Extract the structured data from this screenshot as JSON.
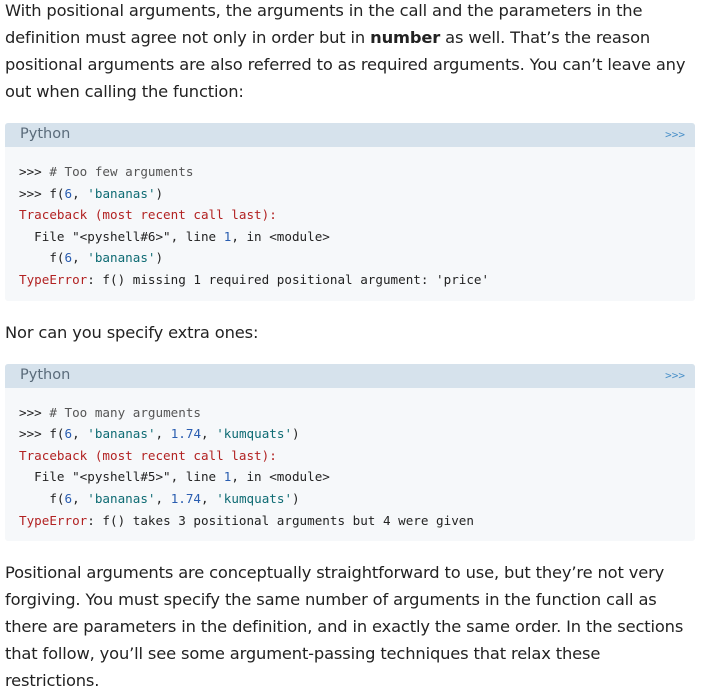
{
  "para1": {
    "before": "With positional arguments, the arguments in the call and the parameters in the definition must agree not only in order but in ",
    "bold": "number",
    "after": " as well. That’s the reason positional arguments are also referred to as required arguments. You can’t leave any out when calling the function:"
  },
  "block1": {
    "lang": "Python",
    "toggle": ">>>",
    "lines": {
      "l1_prompt": ">>> ",
      "l1_comment": "# Too few arguments",
      "l2_prompt": ">>> ",
      "l2_a": "f(",
      "l2_n1": "6",
      "l2_b": ", ",
      "l2_s1": "'bananas'",
      "l2_c": ")",
      "l3": "Traceback (most recent call last):",
      "l4_a": "  File \"<pyshell#6>\", line ",
      "l4_n": "1",
      "l4_b": ", in <module>",
      "l5_a": "    f(",
      "l5_n1": "6",
      "l5_b": ", ",
      "l5_s1": "'bananas'",
      "l5_c": ")",
      "l6_err": "TypeError",
      "l6_msg": ": f() missing 1 required positional argument: 'price'"
    }
  },
  "para2": "Nor can you specify extra ones:",
  "block2": {
    "lang": "Python",
    "toggle": ">>>",
    "lines": {
      "l1_prompt": ">>> ",
      "l1_comment": "# Too many arguments",
      "l2_prompt": ">>> ",
      "l2_a": "f(",
      "l2_n1": "6",
      "l2_b": ", ",
      "l2_s1": "'bananas'",
      "l2_c": ", ",
      "l2_n2": "1.74",
      "l2_d": ", ",
      "l2_s2": "'kumquats'",
      "l2_e": ")",
      "l3": "Traceback (most recent call last):",
      "l4_a": "  File \"<pyshell#5>\", line ",
      "l4_n": "1",
      "l4_b": ", in <module>",
      "l5_a": "    f(",
      "l5_n1": "6",
      "l5_b": ", ",
      "l5_s1": "'bananas'",
      "l5_c": ", ",
      "l5_n2": "1.74",
      "l5_d": ", ",
      "l5_s2": "'kumquats'",
      "l5_e": ")",
      "l6_err": "TypeError",
      "l6_msg": ": f() takes 3 positional arguments but 4 were given"
    }
  },
  "para3": "Positional arguments are conceptually straightforward to use, but they’re not very forgiving. You must specify the same number of arguments in the function call as there are parameters in the definition, and in exactly the same order. In the sections that follow, you’ll see some argument-passing techniques that relax these restrictions."
}
